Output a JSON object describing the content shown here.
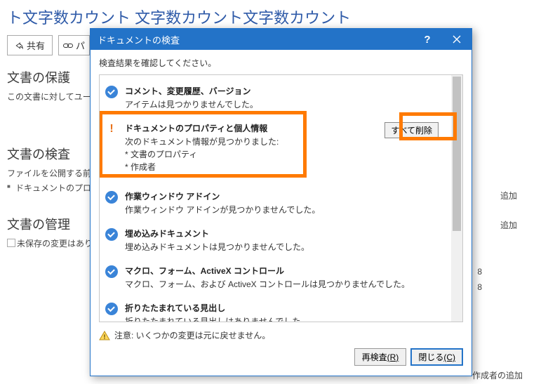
{
  "bg": {
    "page_title": "ト文字数カウント 文字数カウント文字数カウント",
    "share_label": "共有",
    "link_partial": "パ",
    "section1": {
      "title": "文書の保護",
      "sub": "この文書に対してユーザーが"
    },
    "section2": {
      "title": "文書の検査",
      "sub": "ファイルを公開する前に、ファ",
      "bullet": "ドキュメントのプロパティ"
    },
    "section3": {
      "title": "文書の管理",
      "bullet": "未保存の変更はありま"
    },
    "side1": "追加",
    "side2": "追加",
    "side3": "8",
    "side4": "8",
    "side5": "作成者の追加"
  },
  "dialog": {
    "title": "ドキュメントの検査",
    "instruction": "検査結果を確認してください。",
    "help": "?",
    "items": [
      {
        "icon": "check",
        "title": "コメント、変更履歴、バージョン",
        "desc": "アイテムは見つかりませんでした。"
      },
      {
        "icon": "warn",
        "title": "ドキュメントのプロパティと個人情報",
        "desc": "次のドキュメント情報が見つかりました:\n* 文書のプロパティ\n* 作成者",
        "action": "すべて削除"
      },
      {
        "icon": "check",
        "title": "作業ウィンドウ アドイン",
        "desc": "作業ウィンドウ アドインが見つかりませんでした。"
      },
      {
        "icon": "check",
        "title": "埋め込みドキュメント",
        "desc": "埋め込みドキュメントは見つかりませんでした。"
      },
      {
        "icon": "check",
        "title": "マクロ、フォーム、ActiveX コントロール",
        "desc": "マクロ、フォーム、および ActiveX コントロールは見つかりませんでした。"
      },
      {
        "icon": "check",
        "title": "折りたたまれている見出し",
        "desc": "折りたたまれている見出しはありませんでした。"
      }
    ],
    "warning": "注意: いくつかの変更は元に戻せません。",
    "reinspect_label": "再検査",
    "reinspect_key": "(R)",
    "close_label": "閉じる",
    "close_key": "(C)"
  }
}
